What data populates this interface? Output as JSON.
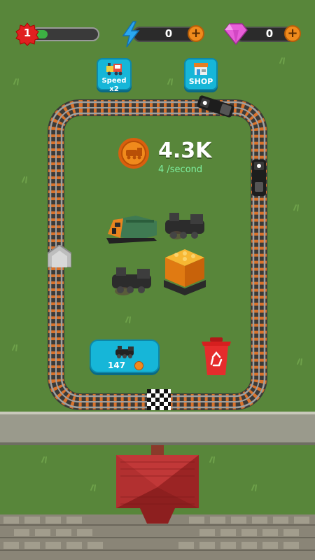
{
  "hud": {
    "level": "1",
    "level_progress": 0.22,
    "energy_count": "0",
    "gem_count": "0"
  },
  "buttons": {
    "speed_label": "Speed x2",
    "shop_label": "SHOP",
    "buy_cost": "147"
  },
  "income": {
    "total": "4.3K",
    "rate": "4 /second"
  },
  "icons": {
    "level": "red-star-badge-icon",
    "energy": "lightning-icon",
    "gem": "pink-gem-icon",
    "coin": "train-coin-icon",
    "recycle": "recycle-bin-icon"
  },
  "colors": {
    "grass": "#58863a",
    "rail": "#d9722b",
    "button": "#16b6d8",
    "plus": "#f08a1c",
    "rate_text": "#7ef0a0"
  }
}
